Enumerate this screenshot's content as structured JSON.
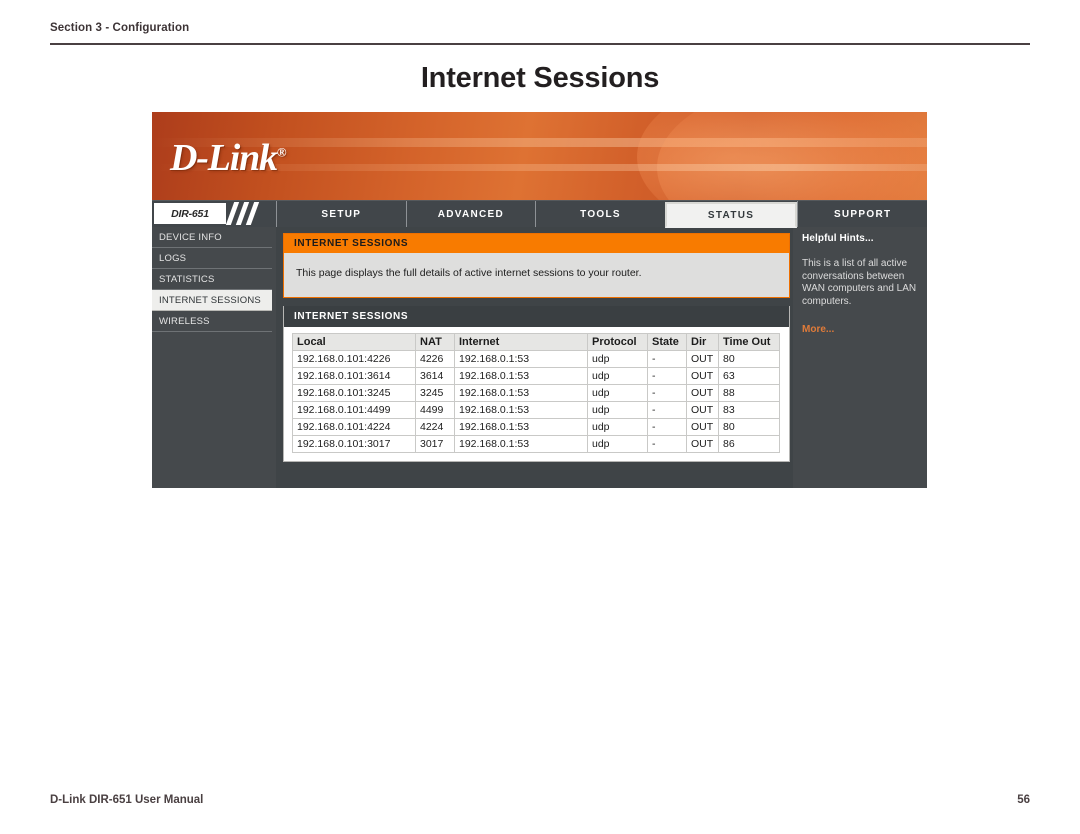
{
  "manual": {
    "section_label": "Section 3 - Configuration",
    "page_title": "Internet Sessions",
    "footer_left": "D-Link DIR-651 User Manual",
    "footer_page": "56"
  },
  "router": {
    "brand": "D-Link",
    "brand_mark": "®",
    "model": "DIR-651",
    "nav_tabs": [
      {
        "label": "SETUP",
        "active": false
      },
      {
        "label": "ADVANCED",
        "active": false
      },
      {
        "label": "TOOLS",
        "active": false
      },
      {
        "label": "STATUS",
        "active": true
      },
      {
        "label": "SUPPORT",
        "active": false
      }
    ],
    "sidebar": {
      "items": [
        {
          "label": "DEVICE INFO",
          "active": false
        },
        {
          "label": "LOGS",
          "active": false
        },
        {
          "label": "STATISTICS",
          "active": false
        },
        {
          "label": "INTERNET SESSIONS",
          "active": true
        },
        {
          "label": "WIRELESS",
          "active": false
        }
      ]
    },
    "info_panel": {
      "title": "INTERNET SESSIONS",
      "description": "This page displays the full details of active internet sessions to your router."
    },
    "sessions_panel": {
      "title": "INTERNET SESSIONS",
      "columns": [
        "Local",
        "NAT",
        "Internet",
        "Protocol",
        "State",
        "Dir",
        "Time Out"
      ],
      "rows": [
        [
          "192.168.0.101:4226",
          "4226",
          "192.168.0.1:53",
          "udp",
          "-",
          "OUT",
          "80"
        ],
        [
          "192.168.0.101:3614",
          "3614",
          "192.168.0.1:53",
          "udp",
          "-",
          "OUT",
          "63"
        ],
        [
          "192.168.0.101:3245",
          "3245",
          "192.168.0.1:53",
          "udp",
          "-",
          "OUT",
          "88"
        ],
        [
          "192.168.0.101:4499",
          "4499",
          "192.168.0.1:53",
          "udp",
          "-",
          "OUT",
          "83"
        ],
        [
          "192.168.0.101:4224",
          "4224",
          "192.168.0.1:53",
          "udp",
          "-",
          "OUT",
          "80"
        ],
        [
          "192.168.0.101:3017",
          "3017",
          "192.168.0.1:53",
          "udp",
          "-",
          "OUT",
          "86"
        ]
      ]
    },
    "hints": {
      "title": "Helpful Hints...",
      "body": "This is a list of all active conversations between WAN computers and LAN computers.",
      "more_label": "More..."
    },
    "colors": {
      "accent_orange": "#f87b00",
      "banner_orange": "#d4632a",
      "dark_chrome": "#45494c",
      "link_orange": "#e07b39"
    }
  }
}
